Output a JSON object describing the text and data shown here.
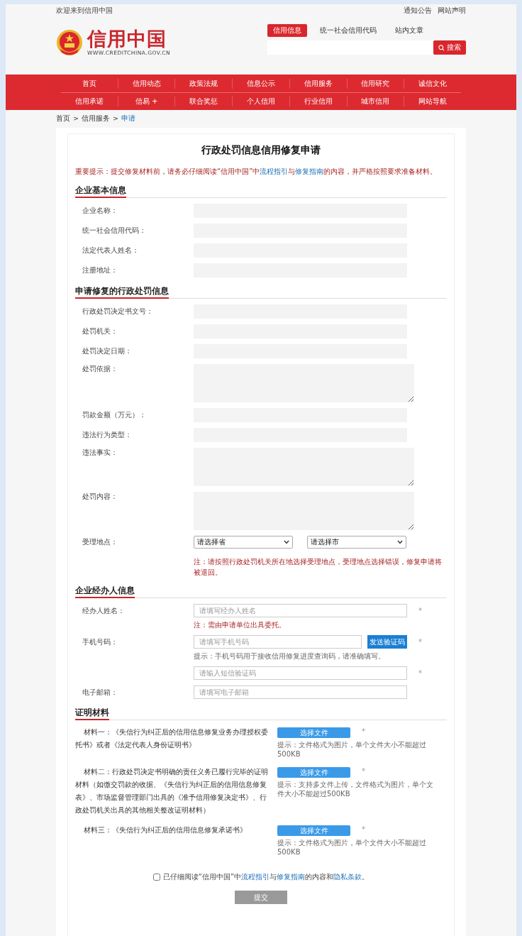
{
  "top_bar": {
    "greeting": "欢迎来到信用中国",
    "links": [
      "通知公告",
      "网站声明"
    ]
  },
  "logo": {
    "name": "信用中国",
    "url": "WWW.CREDITCHINA.GOV.CN"
  },
  "search": {
    "tabs": [
      {
        "label": "信用信息",
        "selected": true
      },
      {
        "label": "统一社会信用代码",
        "selected": false
      },
      {
        "label": "站内文章",
        "selected": false
      }
    ],
    "button": "搜索"
  },
  "nav": [
    [
      "首页",
      "信用动态",
      "政策法规",
      "信息公示",
      "信用服务",
      "信用研究",
      "诚信文化"
    ],
    [
      "信用承诺",
      "信易 +",
      "联合奖惩",
      "个人信用",
      "行业信用",
      "城市信用",
      "网站导航"
    ]
  ],
  "breadcrumb": [
    {
      "label": "首页",
      "current": false
    },
    {
      "label": "信用服务",
      "current": false
    },
    {
      "label": "申请",
      "current": true
    }
  ],
  "breadcrumb_separator": ">",
  "form": {
    "title": "行政处罚信息信用修复申请",
    "notice": [
      {
        "kind": "text",
        "text": "重要提示：提交修复材料前，请务必仔细阅读“信用中国”中"
      },
      {
        "kind": "link",
        "text": "流程指引"
      },
      {
        "kind": "text",
        "text": "与"
      },
      {
        "kind": "link",
        "text": "修复指南"
      },
      {
        "kind": "text",
        "text": "的内容，并严格按照要求准备材料。"
      }
    ],
    "sections": [
      {
        "title": "企业基本信息",
        "fields": [
          {
            "kind": "input",
            "label": "企业名称："
          },
          {
            "kind": "input",
            "label": "统一社会信用代码："
          },
          {
            "kind": "input",
            "label": "法定代表人姓名："
          },
          {
            "kind": "input",
            "label": "注册地址："
          }
        ]
      },
      {
        "title": "申请修复的行政处罚信息",
        "fields": [
          {
            "kind": "input",
            "label": "行政处罚决定书文号："
          },
          {
            "kind": "input",
            "label": "处罚机关："
          },
          {
            "kind": "input",
            "label": "处罚决定日期："
          },
          {
            "kind": "textarea",
            "label": "处罚依据："
          },
          {
            "kind": "input",
            "label": "罚款金额（万元）："
          },
          {
            "kind": "input",
            "label": "违法行为类型："
          },
          {
            "kind": "textarea",
            "label": "违法事实："
          },
          {
            "kind": "textarea",
            "label": "处罚内容："
          },
          {
            "kind": "selects",
            "label": "受理地点：",
            "options": [
              "请选择省",
              "请选择市"
            ],
            "note": "注：请按照行政处罚机关所在地选择受理地点，受理地点选择错误，修复申请将被退回。"
          }
        ]
      },
      {
        "title": "企业经办人信息",
        "fields": [
          {
            "kind": "outlined",
            "label": "经办人姓名：",
            "placeholder": "请填写经办人姓名",
            "mark": "*",
            "note": "注：需由申请单位出具委托。"
          },
          {
            "kind": "outlined",
            "label": "手机号码：",
            "placeholder": "请填写手机号码",
            "button": "发送验证码",
            "mark": "*",
            "hint": "提示：手机号码用于接收信用修复进度查询码，请准确填写。"
          },
          {
            "kind": "outlined",
            "placeholder": "请输入短信验证码",
            "mark": "*"
          },
          {
            "kind": "outlined",
            "label": "电子邮箱：",
            "placeholder": "请填写电子邮箱"
          }
        ]
      }
    ],
    "materials": {
      "title": "证明材料",
      "items": [
        {
          "text": "材料一：《失信行为纠正后的信用信息修复业务办理授权委托书》或者《法定代表人身份证明书》",
          "button": "选择文件",
          "mark": "*",
          "hint": "提示：文件格式为图片，单个文件大小不能超过500KB"
        },
        {
          "text": "材料二：行政处罚决定书明确的责任义务已履行完毕的证明材料（如缴交罚款的收据、《失信行为纠正后的信用信息修复表》、市场监督管理部门出具的《准予信用修复决定书》、行政处罚机关出具的其他相关整改证明材料）",
          "button": "选择文件",
          "mark": "*",
          "hint": "提示：支持多文件上传，文件格式为图片，单个文件大小不能超过500KB"
        },
        {
          "text": "材料三：《失信行为纠正后的信用信息修复承诺书》",
          "button": "选择文件",
          "mark": "*",
          "hint": "提示：文件格式为图片，单个文件大小不能超过500KB"
        }
      ]
    },
    "agreement": {
      "checked": false,
      "parts": [
        {
          "kind": "text",
          "text": "已仔细阅读“信用中国”中"
        },
        {
          "kind": "link",
          "text": "流程指引"
        },
        {
          "kind": "text",
          "text": "与"
        },
        {
          "kind": "link",
          "text": "修复指南"
        },
        {
          "kind": "text",
          "text": "的内容和"
        },
        {
          "kind": "link",
          "text": "隐私条款"
        },
        {
          "kind": "text",
          "text": "。"
        }
      ]
    },
    "submit": "提交"
  }
}
